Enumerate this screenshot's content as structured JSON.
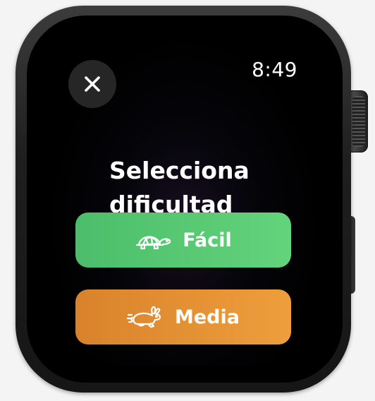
{
  "status": {
    "time": "8:49"
  },
  "header": {
    "close_icon": "close-icon"
  },
  "title": {
    "line1": "Selecciona",
    "line2": "dificultad"
  },
  "options": [
    {
      "label": "Fácil",
      "icon": "turtle-icon",
      "color": "#58c873"
    },
    {
      "label": "Media",
      "icon": "rabbit-icon",
      "color": "#e48f33"
    }
  ],
  "colors": {
    "background": "#000000",
    "text": "#ffffff",
    "close_button_bg": "#262626"
  }
}
